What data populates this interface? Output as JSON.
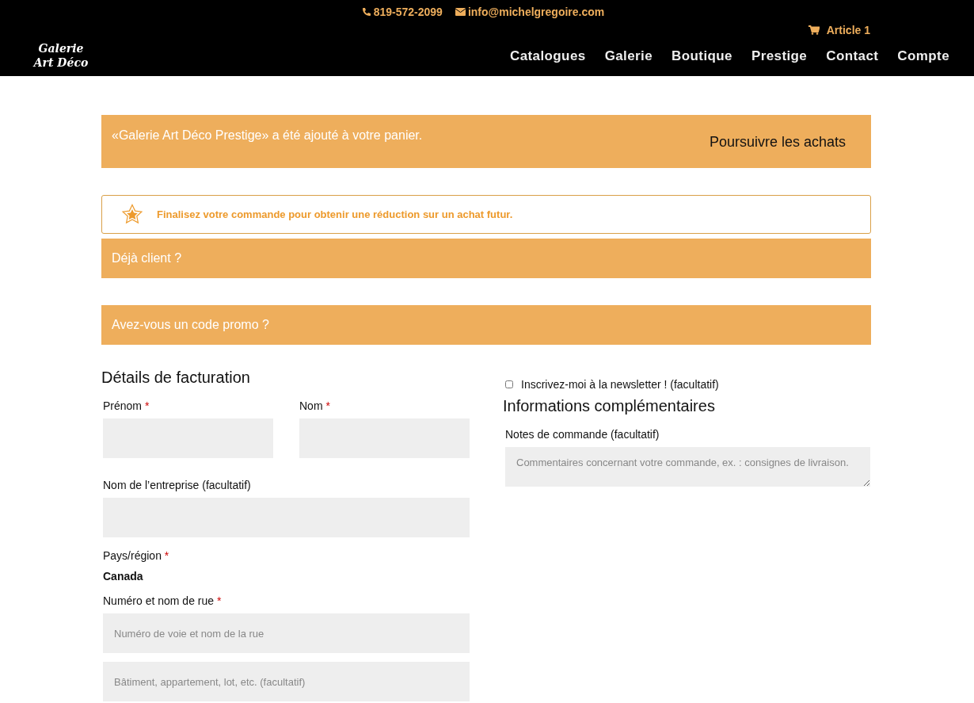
{
  "header": {
    "phone": "819-572-2099",
    "email": "info@michelgregoire.com",
    "cart": "Article 1",
    "logo": [
      "Galerie",
      "Art Déco"
    ],
    "nav": [
      {
        "label": "Catalogues"
      },
      {
        "label": "Galerie"
      },
      {
        "label": "Boutique"
      },
      {
        "label": "Prestige"
      },
      {
        "label": "Contact"
      },
      {
        "label": "Compte"
      }
    ]
  },
  "cart_notice": {
    "message": "«Galerie Art Déco Prestige» a été ajouté à votre panier.",
    "button": "Poursuivre les achats"
  },
  "reward_notice": "Finalisez votre commande pour obtenir une réduction sur un achat futur.",
  "toggles": [
    {
      "label": "Déjà client ?"
    },
    {
      "label": "Avez-vous un code promo ?"
    }
  ],
  "billing": {
    "title": "Détails de facturation",
    "groups": [
      {
        "kind": "pair",
        "fields": [
          {
            "label": "Prénom",
            "required_mark": "*"
          },
          {
            "label": "Nom",
            "required_mark": "*"
          }
        ]
      },
      {
        "kind": "blank_input",
        "label": "Nom de l’entreprise (facultatif)"
      },
      {
        "kind": "static",
        "label": "Pays/région",
        "required_mark": "*",
        "value": "Canada"
      },
      {
        "kind": "input",
        "label": "Numéro et nom de rue",
        "required_mark": "*",
        "inputs": [
          {
            "placeholder": "Numéro de voie et nom de la rue"
          },
          {
            "placeholder": "Bâtiment, appartement, lot, etc. (facultatif)"
          }
        ]
      }
    ]
  },
  "newsletter": {
    "label": "Inscrivez-moi à la newsletter ! (facultatif)",
    "checked": false
  },
  "additional": {
    "title": "Informations complémentaires",
    "notes_label": "Notes de commande (facultatif)",
    "notes_placeholder": "Commentaires concernant votre commande, ex. : consignes de livraison."
  }
}
